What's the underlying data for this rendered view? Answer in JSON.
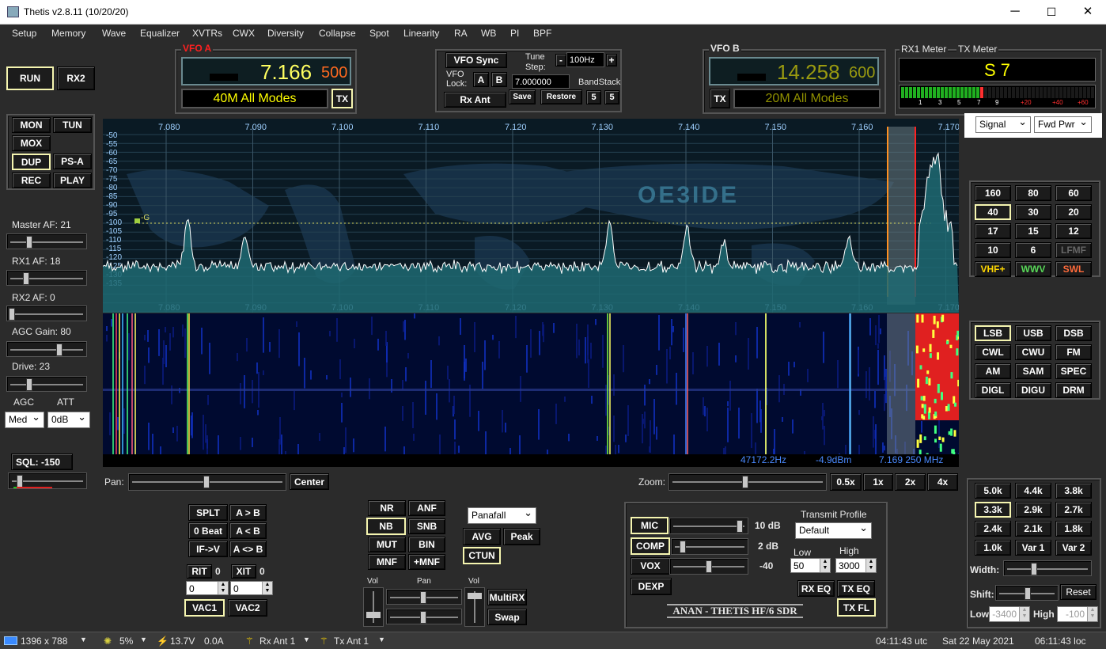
{
  "window": {
    "title": "Thetis v2.8.11 (10/20/20)",
    "min": "─",
    "max": "☐",
    "close": "✕"
  },
  "menu": [
    "Setup",
    "Memory",
    "Wave",
    "Equalizer",
    "XVTRs",
    "CWX",
    "Diversity",
    "Collapse",
    "Spot",
    "Linearity",
    "RA",
    "WB",
    "PI",
    "BPF"
  ],
  "left": {
    "run": "RUN",
    "rx2": "RX2",
    "mon": "MON",
    "tun": "TUN",
    "mox": "MOX",
    "dup": "DUP",
    "psa": "PS-A",
    "rec": "REC",
    "play": "PLAY",
    "master_af": "Master AF:  21",
    "rx1_af": "RX1 AF:  18",
    "rx2_af": "RX2 AF:  0",
    "agc_gain": "AGC Gain:  80",
    "drive": "Drive:  23",
    "agc": "AGC",
    "att": "ATT",
    "agc_val": "Med",
    "att_val": "0dB",
    "sql": "SQL:  -150"
  },
  "vfoa": {
    "label": "VFO A",
    "freq": "7.166",
    "sub": "500",
    "band": "40M All Modes",
    "tx": "TX"
  },
  "vfob": {
    "label": "VFO B",
    "freq": "14.258",
    "sub": "600",
    "band": "20M All Modes",
    "tx": "TX"
  },
  "center": {
    "vfo_sync": "VFO Sync",
    "tune_step": "Tune\nStep:",
    "tune_step1": "Tune",
    "tune_step2": "Step:",
    "minus": "-",
    "step": "100Hz",
    "plus": "+",
    "vfo_lock1": "VFO",
    "vfo_lock2": "Lock:",
    "a": "A",
    "b": "B",
    "freq": "7.000000",
    "bandstack": "BandStack",
    "rx_ant": "Rx Ant",
    "save": "Save",
    "restore": "Restore",
    "s1": "5",
    "s2": "5"
  },
  "meter": {
    "rx1": "RX1 Meter",
    "tx": "TX Meter",
    "reading": "S 7",
    "scale": [
      "1",
      "3",
      "5",
      "7",
      "9",
      "+20",
      "+40",
      "+60"
    ],
    "sel1": "Signal",
    "sel2": "Fwd Pwr"
  },
  "display": {
    "freqs": [
      "7.080",
      "7.090",
      "7.100",
      "7.110",
      "7.120",
      "7.130",
      "7.140",
      "7.150",
      "7.160",
      "7.170"
    ],
    "dbs": [
      "-50",
      "-55",
      "-60",
      "-65",
      "-70",
      "-75",
      "-80",
      "-85",
      "-90",
      "-95",
      "-100",
      "-105",
      "-110",
      "-115",
      "-120",
      "-125",
      "-130",
      "-135"
    ],
    "callsign": "OE3IDE",
    "marker": "-G",
    "readout_hz": "47172.2Hz",
    "readout_dbm": "-4.9dBm",
    "readout_mhz": "7.169 250 MHz"
  },
  "bands": [
    "160",
    "80",
    "60",
    "40",
    "30",
    "20",
    "17",
    "15",
    "12",
    "10",
    "6",
    "LFMF",
    "VHF+",
    "WWV",
    "SWL"
  ],
  "modes": [
    "LSB",
    "USB",
    "DSB",
    "CWL",
    "CWU",
    "FM",
    "AM",
    "SAM",
    "SPEC",
    "DIGL",
    "DIGU",
    "DRM"
  ],
  "filters": [
    "5.0k",
    "4.4k",
    "3.8k",
    "3.3k",
    "2.9k",
    "2.7k",
    "2.4k",
    "2.1k",
    "1.8k",
    "1.0k",
    "Var 1",
    "Var 2"
  ],
  "filter_ctl": {
    "width": "Width:",
    "shift": "Shift:",
    "reset": "Reset",
    "low": "Low",
    "low_val": "-3400",
    "high": "High",
    "high_val": "-100"
  },
  "pan": {
    "pan": "Pan:",
    "center": "Center",
    "zoom": "Zoom:",
    "z05": "0.5x",
    "z1": "1x",
    "z2": "2x",
    "z4": "4x"
  },
  "vfo_ops": {
    "splt": "SPLT",
    "atob": "A > B",
    "zerobeat": "0 Beat",
    "btoa": "A < B",
    "ifv": "IF->V",
    "swap": "A <> B",
    "rit": "RIT",
    "rit_n": "0",
    "xit": "XIT",
    "xit_n": "0",
    "rit_val": "0",
    "xit_val": "0",
    "vac1": "VAC1",
    "vac2": "VAC2"
  },
  "dsp": {
    "nr": "NR",
    "anf": "ANF",
    "nb": "NB",
    "snb": "SNB",
    "mut": "MUT",
    "bin": "BIN",
    "mnf": "MNF",
    "pmnf": "+MNF",
    "panafall": "Panafall",
    "avg": "AVG",
    "peak": "Peak",
    "ctun": "CTUN"
  },
  "mix": {
    "vol": "Vol",
    "pan": "Pan",
    "vol2": "Vol",
    "multirx": "MultiRX",
    "swap": "Swap"
  },
  "tx": {
    "mic": "MIC",
    "mic_val": "10 dB",
    "comp": "COMP",
    "comp_val": "2 dB",
    "vox": "VOX",
    "vox_val": "-40",
    "dexp": "DEXP",
    "profile": "Transmit Profile",
    "profile_val": "Default",
    "low": "Low",
    "high": "High",
    "low_val": "50",
    "high_val": "3000",
    "rxeq": "RX EQ",
    "txeq": "TX EQ",
    "txfl": "TX FL",
    "brand": "ANAN - THETIS HF/6 SDR"
  },
  "status": {
    "res": "1396 x 788",
    "cpu": "5%",
    "volt": "13.7V",
    "amp": "0.0A",
    "rxant": "Rx Ant  1",
    "txant": "Tx Ant  1",
    "utc": "04:11:43 utc",
    "date": "Sat 22 May 2021",
    "loc": "06:11:43 loc"
  },
  "colors": {
    "vfoa_freq": "#ffff60",
    "vfoa_sub": "#ff6a20",
    "vfob_freq": "#9a9a10",
    "band_text": "#ffff00",
    "band_text_dim": "#909000",
    "accent_on": "#f5f5b0",
    "vhf": "#ffd700",
    "wwv": "#58d858",
    "swl": "#ff6a3a"
  }
}
